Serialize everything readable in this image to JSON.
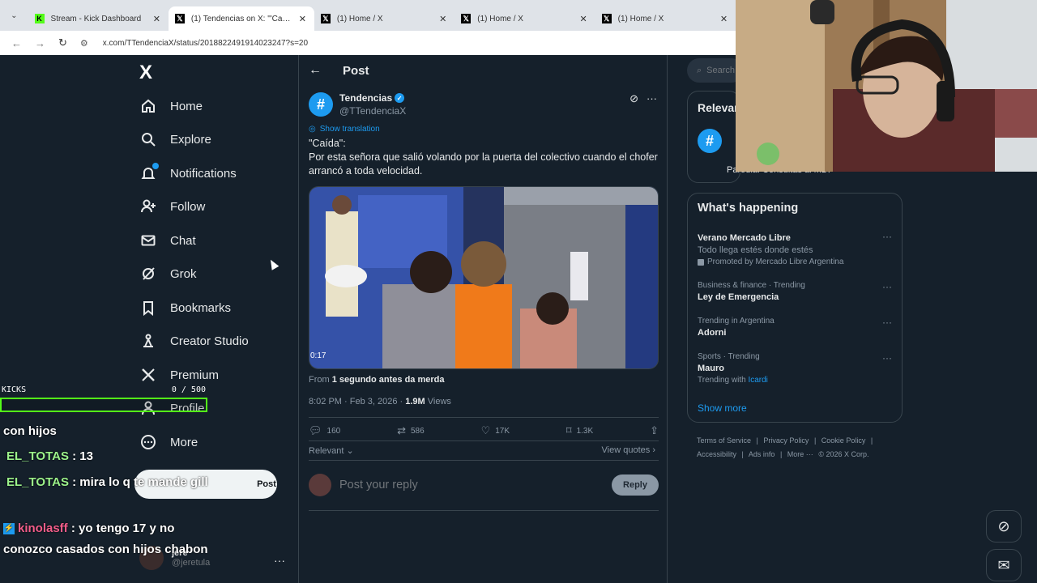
{
  "browser": {
    "tabs": [
      {
        "title": "Stream - Kick Dashboard",
        "icon": "kick-icon",
        "active": false
      },
      {
        "title": "(1) Tendencias on X: \"'Caída': P",
        "icon": "x-logo-icon",
        "active": true
      },
      {
        "title": "(1) Home / X",
        "icon": "x-logo-icon",
        "active": false
      },
      {
        "title": "(1) Home / X",
        "icon": "x-logo-icon",
        "active": false
      },
      {
        "title": "(1) Home / X",
        "icon": "x-logo-icon",
        "active": false
      }
    ],
    "url": "x.com/TTendenciaX/status/2018822491914023247?s=20"
  },
  "nav": {
    "logo": "X",
    "items": [
      {
        "label": "Home",
        "icon": "home-icon"
      },
      {
        "label": "Explore",
        "icon": "search-icon"
      },
      {
        "label": "Notifications",
        "icon": "bell-icon"
      },
      {
        "label": "Follow",
        "icon": "follow-icon"
      },
      {
        "label": "Chat",
        "icon": "mail-icon"
      },
      {
        "label": "Grok",
        "icon": "grok-icon"
      },
      {
        "label": "Bookmarks",
        "icon": "bookmark-icon"
      },
      {
        "label": "Creator Studio",
        "icon": "creator-studio-icon"
      },
      {
        "label": "Premium",
        "icon": "x-premium-icon"
      },
      {
        "label": "Profile",
        "icon": "person-icon"
      },
      {
        "label": "More",
        "icon": "more-circle-icon"
      }
    ],
    "post_button": "Post",
    "account": {
      "name": "jere",
      "handle": "@jeretula"
    }
  },
  "stream_chat": {
    "kicks_label": "KICKS",
    "kicks_count": "0 / 500",
    "messages": [
      {
        "user": "",
        "text": "con hijos"
      },
      {
        "user": "EL_TOTAS",
        "text": ": 13"
      },
      {
        "user": "EL_TOTAS",
        "text": ": mira lo q te mande gill"
      },
      {
        "user": "kinolasff",
        "text": ": yo tengo 17 y no conozco casados con hijos chabon"
      }
    ]
  },
  "post": {
    "header_title": "Post",
    "author_name": "Tendencias",
    "author_handle": "@TTendenciaX",
    "show_translation": "Show translation",
    "text": "\"Caída\":\nPor esta señora que salió volando por la puerta del colectivo cuando el chofer arrancó a toda velocidad.",
    "video_duration": "0:17",
    "from_prefix": "From",
    "from_source": "1 segundo antes da merda",
    "timestamp": "8:02 PM · Feb 3, 2026 ·",
    "views_count": "1.9M",
    "views_label": "Views",
    "stats": {
      "replies": "160",
      "reposts": "586",
      "likes": "17K",
      "bookmarks": "1.3K"
    },
    "sort_label": "Relevant",
    "view_quotes": "View quotes",
    "reply_placeholder": "Post your reply",
    "reply_button": "Reply"
  },
  "sidebar": {
    "search_placeholder": "Search",
    "relevant_title": "Relevant",
    "relevant_bio": "Parodia. Consultas al MD.",
    "happening_title": "What's happening",
    "trends": [
      {
        "context": "",
        "name": "Verano Mercado Libre",
        "sub": "Todo llega estés donde estés",
        "promo": "Promoted by Mercado Libre Argentina"
      },
      {
        "context": "Business & finance · Trending",
        "name": "Ley de Emergencia"
      },
      {
        "context": "Trending in Argentina",
        "name": "Adorni"
      },
      {
        "context": "Sports · Trending",
        "name": "Mauro",
        "with_prefix": "Trending with",
        "with_link": "Icardi"
      }
    ],
    "show_more": "Show more",
    "footer": [
      "Terms of Service",
      "|",
      "Privacy Policy",
      "|",
      "Cookie Policy",
      "|",
      "Accessibility",
      "|",
      "Ads info",
      "|",
      "More ···",
      "© 2026 X Corp."
    ]
  }
}
